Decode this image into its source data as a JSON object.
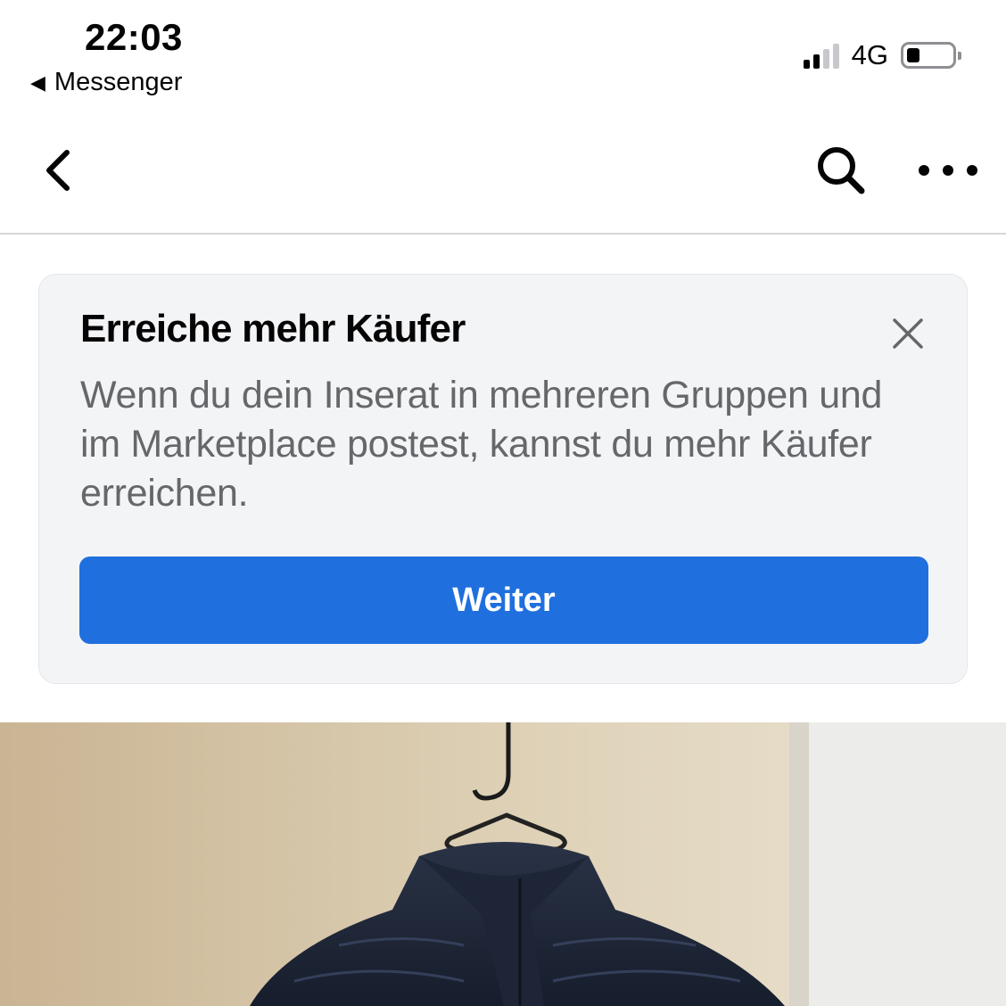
{
  "status_bar": {
    "time": "22:03",
    "back_app": "Messenger",
    "back_app_icon": "back-triangle-icon",
    "network": "4G",
    "signal_bars_filled": 2,
    "signal_bars_total": 4
  },
  "nav": {
    "back_icon": "chevron-left-icon",
    "search_icon": "search-icon",
    "more_icon": "more-horizontal-icon"
  },
  "promo": {
    "title": "Erreiche mehr Käufer",
    "body": "Wenn du dein Inserat in mehreren Gruppen und im Marketplace postest, kannst du mehr Käufer erreichen.",
    "button_label": "Weiter",
    "close_icon": "close-icon",
    "button_color": "#1f6fde"
  },
  "listing": {
    "photo_icon": "jacket-photo"
  }
}
